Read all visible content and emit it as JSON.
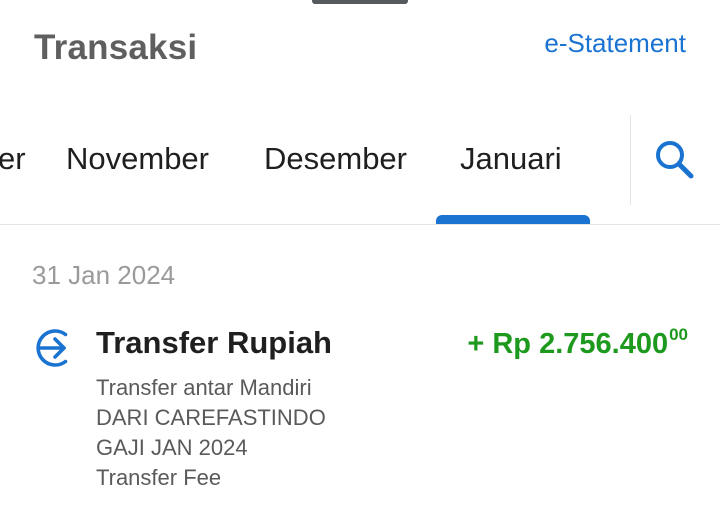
{
  "header": {
    "title": "Transaksi",
    "estatement_label": "e-Statement"
  },
  "month_tabs": {
    "items": [
      {
        "label": "Oktober",
        "visible_fragment": "er"
      },
      {
        "label": "November"
      },
      {
        "label": "Desember"
      },
      {
        "label": "Januari",
        "active": true
      }
    ],
    "search_icon": "search-icon"
  },
  "transactions": {
    "date": "31 Jan 2024",
    "items": [
      {
        "icon": "transfer-arrow-icon",
        "title": "Transfer Rupiah",
        "amount": {
          "sign_currency": "+ Rp ",
          "whole": "2.756.400",
          "decimal": "00"
        },
        "description": [
          "Transfer antar Mandiri",
          "DARI CAREFASTINDO",
          "GAJI JAN 2024",
          "Transfer Fee"
        ]
      }
    ]
  },
  "colors": {
    "accent": "#1a73d1",
    "title": "#5f5f5f",
    "credit": "#1d9a1d",
    "date": "#9a9a9a"
  }
}
